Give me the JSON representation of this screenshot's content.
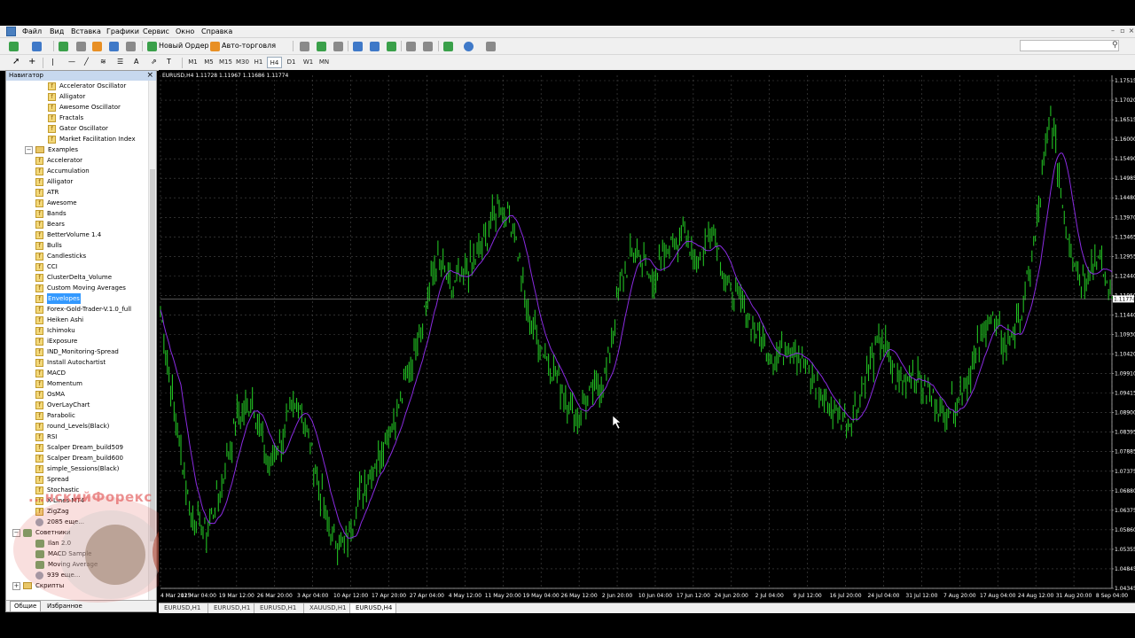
{
  "menu": [
    "Файл",
    "Вид",
    "Вставка",
    "Графики",
    "Сервис",
    "Окно",
    "Справка"
  ],
  "toolbar": {
    "new_order": "Новый Ордер",
    "autotrading": "Авто-торговля"
  },
  "timeframes": [
    "M1",
    "M5",
    "M15",
    "M30",
    "H1",
    "H4",
    "D1",
    "W1",
    "MN"
  ],
  "active_timeframe": "H4",
  "navigator": {
    "title": "Навигатор",
    "items": [
      {
        "label": "Accelerator Oscillator",
        "type": "indicator",
        "level": 2
      },
      {
        "label": "Alligator",
        "type": "indicator",
        "level": 2
      },
      {
        "label": "Awesome Oscillator",
        "type": "indicator",
        "level": 2
      },
      {
        "label": "Fractals",
        "type": "indicator",
        "level": 2
      },
      {
        "label": "Gator Oscillator",
        "type": "indicator",
        "level": 2
      },
      {
        "label": "Market Facilitation Index",
        "type": "indicator",
        "level": 2
      },
      {
        "label": "Examples",
        "type": "folder",
        "level": 1
      },
      {
        "label": "Accelerator",
        "type": "indicator",
        "level": 1
      },
      {
        "label": "Accumulation",
        "type": "indicator",
        "level": 1
      },
      {
        "label": "Alligator",
        "type": "indicator",
        "level": 1
      },
      {
        "label": "ATR",
        "type": "indicator",
        "level": 1
      },
      {
        "label": "Awesome",
        "type": "indicator",
        "level": 1
      },
      {
        "label": "Bands",
        "type": "indicator",
        "level": 1
      },
      {
        "label": "Bears",
        "type": "indicator",
        "level": 1
      },
      {
        "label": "BetterVolume 1.4",
        "type": "indicator",
        "level": 1
      },
      {
        "label": "Bulls",
        "type": "indicator",
        "level": 1
      },
      {
        "label": "Candlesticks",
        "type": "indicator",
        "level": 1
      },
      {
        "label": "CCI",
        "type": "indicator",
        "level": 1
      },
      {
        "label": "ClusterDelta_Volume",
        "type": "indicator",
        "level": 1
      },
      {
        "label": "Custom Moving Averages",
        "type": "indicator",
        "level": 1
      },
      {
        "label": "Envelopes",
        "type": "indicator",
        "level": 1,
        "selected": true
      },
      {
        "label": "Forex-Gold-Trader-V.1.0_full",
        "type": "indicator",
        "level": 1
      },
      {
        "label": "Heiken Ashi",
        "type": "indicator",
        "level": 1
      },
      {
        "label": "Ichimoku",
        "type": "indicator",
        "level": 1
      },
      {
        "label": "iExposure",
        "type": "indicator",
        "level": 1
      },
      {
        "label": "IND_Monitoring-Spread",
        "type": "indicator",
        "level": 1
      },
      {
        "label": "Install Autochartist",
        "type": "indicator",
        "level": 1
      },
      {
        "label": "MACD",
        "type": "indicator",
        "level": 1
      },
      {
        "label": "Momentum",
        "type": "indicator",
        "level": 1
      },
      {
        "label": "OsMA",
        "type": "indicator",
        "level": 1
      },
      {
        "label": "OverLayChart",
        "type": "indicator",
        "level": 1
      },
      {
        "label": "Parabolic",
        "type": "indicator",
        "level": 1
      },
      {
        "label": "round_Levels(Black)",
        "type": "indicator",
        "level": 1
      },
      {
        "label": "RSI",
        "type": "indicator",
        "level": 1
      },
      {
        "label": "Scalper Dream_build509",
        "type": "indicator",
        "level": 1
      },
      {
        "label": "Scalper Dream_build600",
        "type": "indicator",
        "level": 1
      },
      {
        "label": "simple_Sessions(Black)",
        "type": "indicator",
        "level": 1
      },
      {
        "label": "Spread",
        "type": "indicator",
        "level": 1
      },
      {
        "label": "Stochastic",
        "type": "indicator",
        "level": 1
      },
      {
        "label": "X-Lines MT4",
        "type": "indicator",
        "level": 1
      },
      {
        "label": "ZigZag",
        "type": "indicator",
        "level": 1
      },
      {
        "label": "2085 еще...",
        "type": "more",
        "level": 1
      },
      {
        "label": "Советники",
        "type": "ea-folder",
        "level": 0
      },
      {
        "label": "Ilan 2.0",
        "type": "ea",
        "level": 1
      },
      {
        "label": "MACD Sample",
        "type": "ea",
        "level": 1
      },
      {
        "label": "Moving Average",
        "type": "ea",
        "level": 1
      },
      {
        "label": "939 еще...",
        "type": "more",
        "level": 1
      },
      {
        "label": "Скрипты",
        "type": "script-folder",
        "level": 0
      }
    ],
    "tabs": [
      "Общие",
      "Избранное"
    ]
  },
  "watermark_text": "...нскийФорекс",
  "chart": {
    "header": "EURUSD,H4  1.11728 1.11967 1.11686 1.11774",
    "current_price": "1.11774",
    "tabs": [
      "EURUSD,H1",
      "EURUSD,H1",
      "EURUSD,H1",
      "XAUUSD,H1",
      "EURUSD,H4"
    ],
    "active_tab": 4
  },
  "chart_data": {
    "type": "line",
    "title": "EURUSD,H4",
    "price_ticks": [
      "1.17515",
      "1.17020",
      "1.16515",
      "1.16000",
      "1.15490",
      "1.14985",
      "1.14480",
      "1.13970",
      "1.13465",
      "1.12955",
      "1.12440",
      "1.11950",
      "1.11440",
      "1.10930",
      "1.10420",
      "1.09910",
      "1.09415",
      "1.08900",
      "1.08395",
      "1.07885",
      "1.07375",
      "1.06880",
      "1.06375",
      "1.05860",
      "1.05355",
      "1.04845",
      "1.04345"
    ],
    "time_labels": [
      "4 Mar 2015",
      "12 Mar 04:00",
      "19 Mar 12:00",
      "26 Mar 20:00",
      "3 Apr 04:00",
      "10 Apr 12:00",
      "17 Apr 20:00",
      "27 Apr 04:00",
      "4 May 12:00",
      "11 May 20:00",
      "19 May 04:00",
      "26 May 12:00",
      "2 Jun 20:00",
      "10 Jun 04:00",
      "17 Jun 12:00",
      "24 Jun 20:00",
      "2 Jul 04:00",
      "9 Jul 12:00",
      "16 Jul 20:00",
      "24 Jul 04:00",
      "31 Jul 12:00",
      "7 Aug 20:00",
      "17 Aug 04:00",
      "24 Aug 12:00",
      "31 Aug 20:00",
      "8 Sep 04:00"
    ],
    "ylim": [
      1.04345,
      1.17515
    ],
    "series": [
      {
        "values": [
          1.115,
          1.086,
          1.062,
          1.058,
          1.07,
          1.088,
          1.092,
          1.074,
          1.083,
          1.092,
          1.076,
          1.058,
          1.054,
          1.068,
          1.076,
          1.085,
          1.096,
          1.112,
          1.128,
          1.12,
          1.125,
          1.131,
          1.142,
          1.137,
          1.112,
          1.104,
          1.096,
          1.087,
          1.093,
          1.098,
          1.123,
          1.131,
          1.122,
          1.13,
          1.135,
          1.128,
          1.136,
          1.12,
          1.116,
          1.108,
          1.102,
          1.107,
          1.1,
          1.094,
          1.088,
          1.086,
          1.098,
          1.108,
          1.096,
          1.099,
          1.094,
          1.088,
          1.092,
          1.102,
          1.114,
          1.106,
          1.112,
          1.133,
          1.166,
          1.136,
          1.122,
          1.129,
          1.118
        ]
      }
    ],
    "colors": {
      "price": "#22c022",
      "moving_average": "#8a2be2",
      "grid": "#4a4a4a",
      "axis_text": "#ffffff"
    },
    "grid": true
  }
}
